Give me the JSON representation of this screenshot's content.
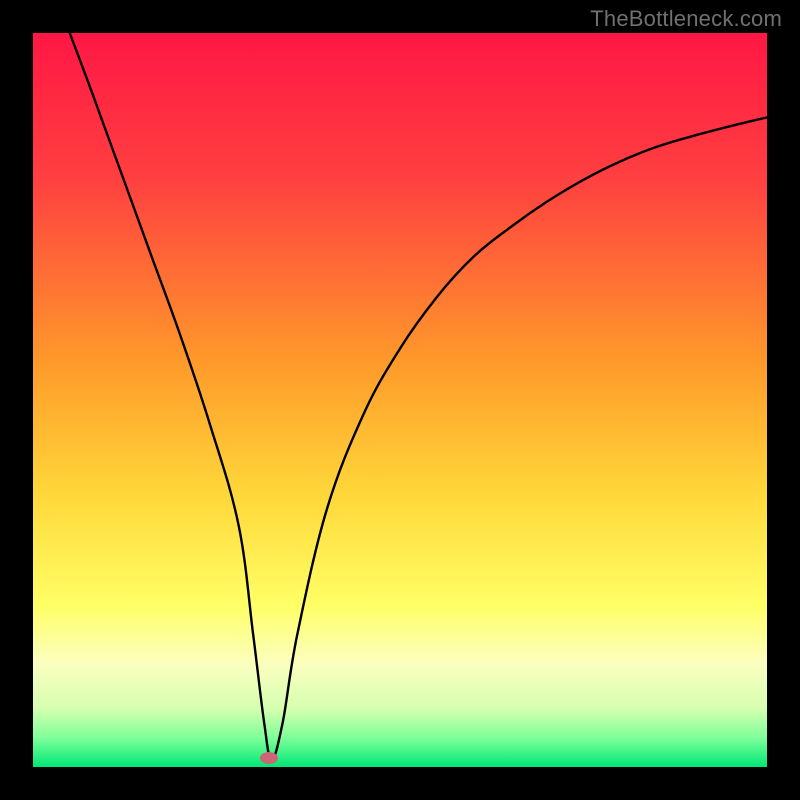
{
  "watermark": "TheBottleneck.com",
  "chart_data": {
    "type": "line",
    "title": "",
    "xlabel": "",
    "ylabel": "",
    "xlim": [
      0,
      100
    ],
    "ylim": [
      0,
      100
    ],
    "gradient_stops": [
      {
        "offset": 0,
        "color": "#ff1744"
      },
      {
        "offset": 20,
        "color": "#ff4040"
      },
      {
        "offset": 45,
        "color": "#ff9a2a"
      },
      {
        "offset": 63,
        "color": "#ffd83a"
      },
      {
        "offset": 78,
        "color": "#ffff66"
      },
      {
        "offset": 86,
        "color": "#fbffbf"
      },
      {
        "offset": 92,
        "color": "#d6ffb0"
      },
      {
        "offset": 96,
        "color": "#7fff9a"
      },
      {
        "offset": 100,
        "color": "#00e876"
      }
    ],
    "series": [
      {
        "name": "bottleneck-curve",
        "x": [
          5,
          8,
          12,
          16,
          20,
          24,
          28,
          30,
          31.5,
          32.5,
          34,
          36,
          40,
          45,
          50,
          55,
          60,
          65,
          70,
          75,
          80,
          85,
          90,
          95,
          100
        ],
        "y": [
          100,
          92,
          81,
          70,
          59,
          47,
          33,
          18,
          6,
          1,
          6,
          18,
          35,
          48,
          57,
          64,
          69.5,
          73.5,
          77,
          80,
          82.5,
          84.5,
          86,
          87.3,
          88.5
        ]
      }
    ],
    "marker": {
      "x": 32.2,
      "y": 1.2
    }
  }
}
